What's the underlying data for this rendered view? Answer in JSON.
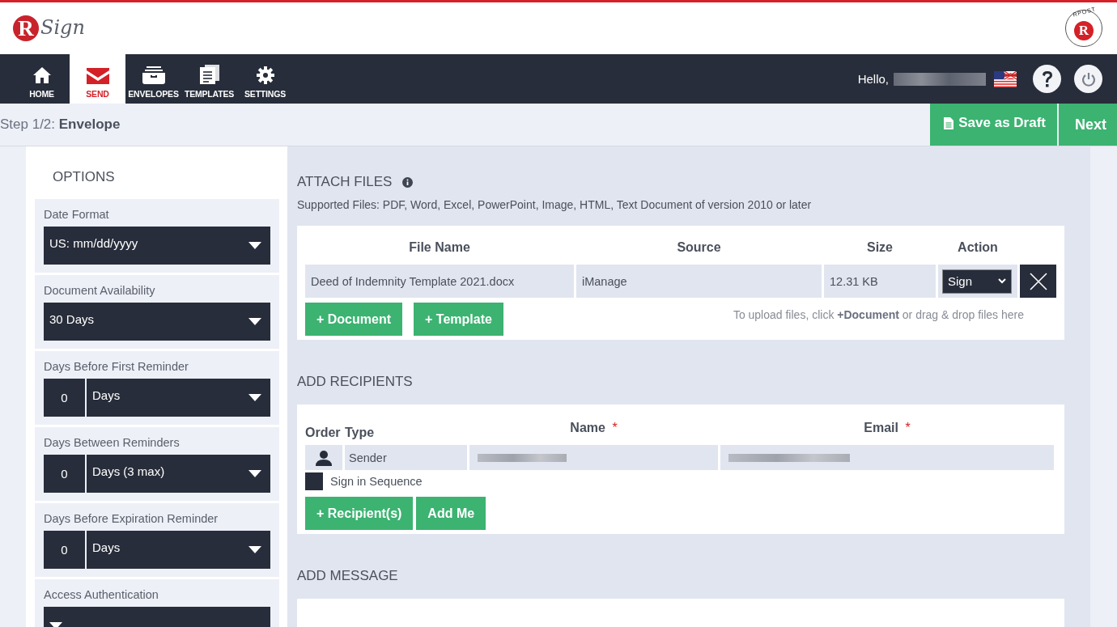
{
  "header": {
    "logo_mark": "R",
    "logo_word": "Sign",
    "brand_arc": "RPOST",
    "brand_mark": "R"
  },
  "nav": {
    "items": [
      {
        "label": "HOME",
        "selected": false
      },
      {
        "label": "SEND",
        "selected": true
      },
      {
        "label": "ENVELOPES",
        "selected": false
      },
      {
        "label": "TEMPLATES",
        "selected": false
      },
      {
        "label": "SETTINGS",
        "selected": false
      }
    ],
    "greeting": "Hello,"
  },
  "step": {
    "prefix": "Step 1/2:",
    "name": "Envelope"
  },
  "actions": {
    "save_draft": "Save as Draft",
    "next": "Next"
  },
  "options": {
    "title": "OPTIONS",
    "fields": [
      {
        "kind": "select",
        "label": "Date Format",
        "value": "US: mm/dd/yyyy"
      },
      {
        "kind": "select",
        "label": "Document Availability",
        "value": "30 Days"
      },
      {
        "kind": "number_select",
        "label": "Days Before First Reminder",
        "number": "0",
        "value": "Days"
      },
      {
        "kind": "number_select",
        "label": "Days Between Reminders",
        "number": "0",
        "value": "Days (3 max)"
      },
      {
        "kind": "number_select",
        "label": "Days Before Expiration Reminder",
        "number": "0",
        "value": "Days"
      },
      {
        "kind": "select",
        "label": "Access Authentication"
      }
    ]
  },
  "attach_files": {
    "title": "ATTACH FILES",
    "supported": "Supported Files: PDF, Word, Excel, PowerPoint, Image, HTML, Text Document of version 2010 or later",
    "columns": [
      "File Name",
      "Source",
      "Size",
      "Action"
    ],
    "rows": [
      {
        "file_name": "Deed of Indemnity Template 2021.docx",
        "source": "iManage",
        "size": "12.31 KB",
        "action": "Sign"
      }
    ],
    "buttons": [
      "+ Document",
      "+ Template"
    ],
    "hint": "To upload files, click **+Document** or drag & drop files here"
  },
  "add_recipients": {
    "title": "ADD RECIPIENTS",
    "columns": [
      {
        "label": "Order",
        "required": false
      },
      {
        "label": "Type",
        "required": false
      },
      {
        "label": "Name",
        "required": true
      },
      {
        "label": "Email",
        "required": true
      }
    ],
    "required_mark": "*",
    "rows": [
      {
        "type": "Sender"
      }
    ],
    "sign_in_sequence": {
      "label": "Sign in Sequence",
      "checked": false
    },
    "buttons": [
      "+ Recipient(s)",
      "Add Me"
    ]
  },
  "add_message": {
    "title": "ADD MESSAGE"
  }
}
